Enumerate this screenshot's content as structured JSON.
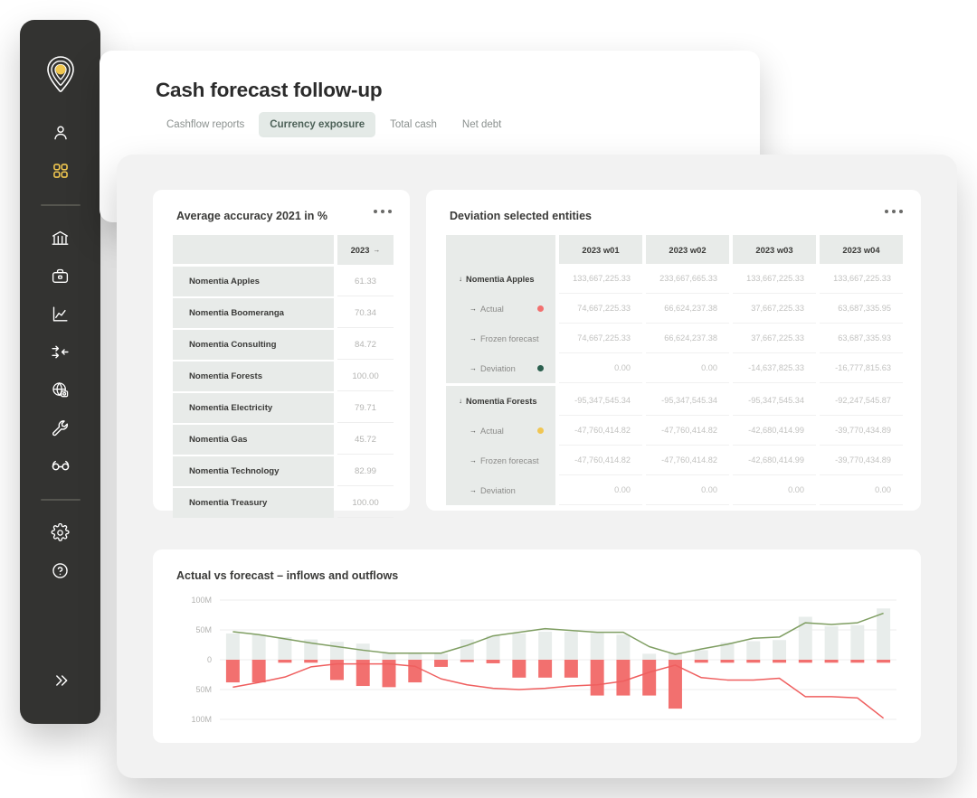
{
  "header": {
    "title": "Cash forecast follow-up",
    "tabs": [
      {
        "label": "Cashflow reports",
        "active": false
      },
      {
        "label": "Currency exposure",
        "active": true
      },
      {
        "label": "Total cash",
        "active": false
      },
      {
        "label": "Net debt",
        "active": false
      }
    ]
  },
  "sidebar": {
    "logo": "nomentia-pin-logo",
    "items": [
      {
        "icon": "user-icon",
        "active": false
      },
      {
        "icon": "dashboard-grid-icon",
        "active": true
      },
      {
        "icon": "bank-icon",
        "active": false
      },
      {
        "icon": "briefcase-icon",
        "active": false
      },
      {
        "icon": "chart-line-icon",
        "active": false
      },
      {
        "icon": "arrows-in-icon",
        "active": false
      },
      {
        "icon": "globe-money-icon",
        "active": false
      },
      {
        "icon": "wrench-icon",
        "active": false
      },
      {
        "icon": "glasses-icon",
        "active": false
      },
      {
        "icon": "gear-icon",
        "active": false
      },
      {
        "icon": "help-circle-icon",
        "active": false
      }
    ],
    "expand_icon": "double-chevron-right-icon",
    "accent_color": "#efc64f"
  },
  "accuracy_card": {
    "title": "Average accuracy 2021 in %",
    "menu_icon": "kebab-menu-icon",
    "columns": [
      "",
      "2023"
    ],
    "sort_indicator": "→",
    "rows": [
      {
        "entity": "Nomentia Apples",
        "value": "61.33"
      },
      {
        "entity": "Nomentia Boomeranga",
        "value": "70.34"
      },
      {
        "entity": "Nomentia Consulting",
        "value": "84.72"
      },
      {
        "entity": "Nomentia Forests",
        "value": "100.00"
      },
      {
        "entity": "Nomentia Electricity",
        "value": "79.71"
      },
      {
        "entity": "Nomentia Gas",
        "value": "45.72"
      },
      {
        "entity": "Nomentia Technology",
        "value": "82.99"
      },
      {
        "entity": "Nomentia Treasury",
        "value": "100.00"
      }
    ]
  },
  "deviation_card": {
    "title": "Deviation selected entities",
    "menu_icon": "kebab-menu-icon",
    "columns": [
      "",
      "2023 w01",
      "2023 w02",
      "2023 w03",
      "2023 w04"
    ],
    "rows": [
      {
        "label": "Nomentia Apples",
        "level": "parent",
        "twisty": "↓",
        "dot": null,
        "values": [
          "133,667,225.33",
          "233,667,665.33",
          "133,667,225.33",
          "133,667,225.33"
        ]
      },
      {
        "label": "Actual",
        "level": "child",
        "twisty": "→",
        "dot": "#f2706f",
        "values": [
          "74,667,225.33",
          "66,624,237.38",
          "37,667,225.33",
          "63,687,335.95"
        ]
      },
      {
        "label": "Frozen forecast",
        "level": "child",
        "twisty": "→",
        "dot": null,
        "values": [
          "74,667,225.33",
          "66,624,237.38",
          "37,667,225.33",
          "63,687,335.93"
        ]
      },
      {
        "label": "Deviation",
        "level": "child",
        "twisty": "→",
        "dot": "#2b5f4e",
        "values": [
          "0.00",
          "0.00",
          "-14,637,825.33",
          "-16,777,815.63"
        ]
      },
      {
        "label": "Nomentia Forests",
        "level": "parent",
        "twisty": "↓",
        "dot": null,
        "values": [
          "-95,347,545.34",
          "-95,347,545.34",
          "-95,347,545.34",
          "-92,247,545.87"
        ]
      },
      {
        "label": "Actual",
        "level": "child",
        "twisty": "→",
        "dot": "#f0c653",
        "values": [
          "-47,760,414.82",
          "-47,760,414.82",
          "-42,680,414.99",
          "-39,770,434.89"
        ]
      },
      {
        "label": "Frozen forecast",
        "level": "child",
        "twisty": "→",
        "dot": null,
        "values": [
          "-47,760,414.82",
          "-47,760,414.82",
          "-42,680,414.99",
          "-39,770,434.89"
        ]
      },
      {
        "label": "Deviation",
        "level": "child",
        "twisty": "→",
        "dot": null,
        "values": [
          "0.00",
          "0.00",
          "0.00",
          "0.00"
        ]
      }
    ]
  },
  "chart_card": {
    "title": "Actual vs forecast – inflows and outflows"
  },
  "chart_data": {
    "type": "bar",
    "title": "Actual vs forecast – inflows and outflows",
    "xlabel": "",
    "ylabel": "",
    "ylim": [
      -100,
      100
    ],
    "yticks": [
      100,
      50,
      0,
      -50,
      -100
    ],
    "ytick_labels": [
      "100M",
      "50M",
      "0",
      "50M",
      "100M"
    ],
    "grid": true,
    "legend_position": "none",
    "unit": "M",
    "x": [
      1,
      2,
      3,
      4,
      5,
      6,
      7,
      8,
      9,
      10,
      11,
      12,
      13,
      14,
      15,
      16,
      17,
      18,
      19,
      20,
      21,
      22,
      23,
      24,
      25,
      26
    ],
    "series": [
      {
        "name": "Inflow bars",
        "type": "bar",
        "color": "#e8edeb",
        "values": [
          44,
          42,
          38,
          34,
          30,
          27,
          12,
          10,
          10,
          34,
          40,
          44,
          47,
          47,
          45,
          42,
          10,
          12,
          16,
          29,
          31,
          33,
          72,
          56,
          58,
          86
        ]
      },
      {
        "name": "Outflow bars",
        "type": "bar",
        "color": "#f2706f",
        "values": [
          -38,
          -38,
          -5,
          -5,
          -34,
          -44,
          -46,
          -38,
          -12,
          -4,
          -6,
          -30,
          -30,
          -30,
          -60,
          -60,
          -60,
          -82,
          -5,
          -5,
          -5,
          -5,
          -5,
          -5,
          -5,
          -5
        ]
      },
      {
        "name": "Forecast inflow line",
        "type": "line",
        "color": "#7f9e62",
        "values": [
          47,
          42,
          35,
          28,
          22,
          16,
          11,
          11,
          11,
          24,
          40,
          46,
          52,
          49,
          46,
          46,
          22,
          9,
          18,
          26,
          36,
          38,
          62,
          59,
          62,
          78
        ]
      },
      {
        "name": "Forecast outflow line",
        "type": "line",
        "color": "#ef5f5f",
        "values": [
          -46,
          -38,
          -29,
          -12,
          -7,
          -7,
          -7,
          -11,
          -32,
          -42,
          -48,
          -50,
          -48,
          -44,
          -42,
          -36,
          -21,
          -9,
          -30,
          -34,
          -34,
          -31,
          -62,
          -62,
          -64,
          -98
        ]
      }
    ]
  }
}
